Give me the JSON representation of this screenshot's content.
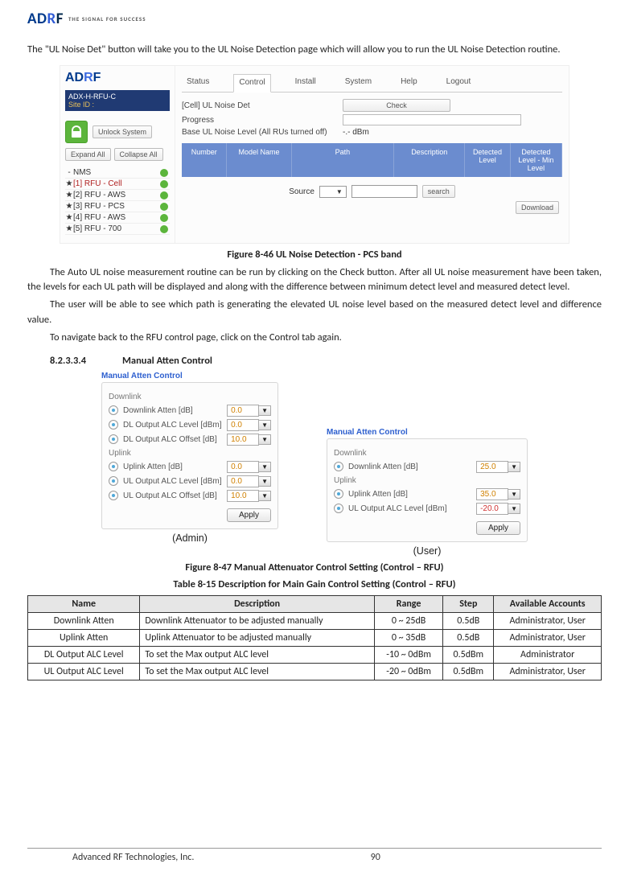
{
  "logo": {
    "brand_a": "AD",
    "brand_r": "R",
    "brand_f": "F",
    "tagline": "THE SIGNAL FOR SUCCESS"
  },
  "intro": "The \"UL Noise Det\" button will take you to the UL Noise Detection page which will allow you to run the UL Noise Detection routine.",
  "shot1": {
    "model": "ADX-H-RFU-C",
    "siteid_label": "Site ID :",
    "unlock": "Unlock System",
    "expand": "Expand All",
    "collapse": "Collapse All",
    "tree": {
      "root": "NMS",
      "rfu1": "[1] RFU - Cell",
      "rfu2": "[2] RFU - AWS",
      "rfu3": "[3] RFU - PCS",
      "rfu4": "[4] RFU - AWS",
      "rfu5": "[5] RFU - 700"
    },
    "tabs": {
      "status": "Status",
      "control": "Control",
      "install": "Install",
      "system": "System",
      "help": "Help",
      "logout": "Logout"
    },
    "kv": {
      "cell_label": "[Cell] UL Noise Det",
      "check": "Check",
      "progress": "Progress",
      "base_label": "Base UL Noise Level (All RUs turned off)",
      "base_val": "-.- dBm"
    },
    "grid": {
      "number": "Number",
      "model": "Model Name",
      "path": "Path",
      "desc": "Description",
      "lvl": "Detected Level",
      "diff": "Detected Level - Min Level"
    },
    "src": {
      "label": "Source",
      "search": "search"
    },
    "download": "Download"
  },
  "caption1": "Figure 8-46   UL Noise Detection - PCS band",
  "p2": "The Auto UL noise measurement routine can be run by clicking on the Check button.  After all UL noise measurement have been taken, the levels for each UL path will be displayed and along with the difference between minimum detect level and measured detect level.",
  "p3": "The user will be able to see which path is generating the elevated UL noise level based on the measured detect level and difference value.",
  "p4": "To navigate back to the RFU control page, click on the Control tab again.",
  "section": {
    "num": "8.2.3.3.4",
    "title": "Manual Atten Control"
  },
  "atten": {
    "title": "Manual Atten Control",
    "downlink": "Downlink",
    "uplink": "Uplink",
    "dl_atten": "Downlink Atten [dB]",
    "dl_alc_lvl": "DL Output ALC Level [dBm]",
    "dl_alc_off": "DL Output ALC Offset [dB]",
    "ul_atten": "Uplink Atten [dB]",
    "ul_alc_lvl": "UL Output ALC Level [dBm]",
    "ul_alc_off": "UL Output ALC Offset [dB]",
    "apply": "Apply",
    "admin_vals": {
      "dl_atten": "0.0",
      "dl_alc_lvl": "0.0",
      "dl_alc_off": "10.0",
      "ul_atten": "0.0",
      "ul_alc_lvl": "0.0",
      "ul_alc_off": "10.0"
    },
    "user_vals": {
      "dl_atten": "25.0",
      "ul_atten": "35.0",
      "ul_alc_lvl": "-20.0"
    },
    "cap_admin": "(Admin)",
    "cap_user": "(User)"
  },
  "caption2": "Figure 8-47   Manual Attenuator Control Setting (Control – RFU)",
  "caption3": "Table 8-15    Description for Main Gain Control Setting (Control – RFU)",
  "table": {
    "h_name": "Name",
    "h_desc": "Description",
    "h_range": "Range",
    "h_step": "Step",
    "h_acc": "Available Accounts",
    "rows": [
      {
        "name": "Downlink Atten",
        "desc": "Downlink Attenuator to be adjusted manually",
        "range": "0 ~ 25dB",
        "step": "0.5dB",
        "acc": "Administrator, User"
      },
      {
        "name": "Uplink Atten",
        "desc": "Uplink Attenuator to be adjusted manually",
        "range": "0 ~ 35dB",
        "step": "0.5dB",
        "acc": "Administrator, User"
      },
      {
        "name": "DL Output ALC Level",
        "desc": "To set the Max output ALC level",
        "range": "-10 ~ 0dBm",
        "step": "0.5dBm",
        "acc": "Administrator"
      },
      {
        "name": "UL Output ALC Level",
        "desc": "To set the Max output ALC level",
        "range": "-20 ~ 0dBm",
        "step": "0.5dBm",
        "acc": "Administrator, User"
      }
    ]
  },
  "footer": {
    "company": "Advanced RF Technologies, Inc.",
    "page": "90"
  }
}
